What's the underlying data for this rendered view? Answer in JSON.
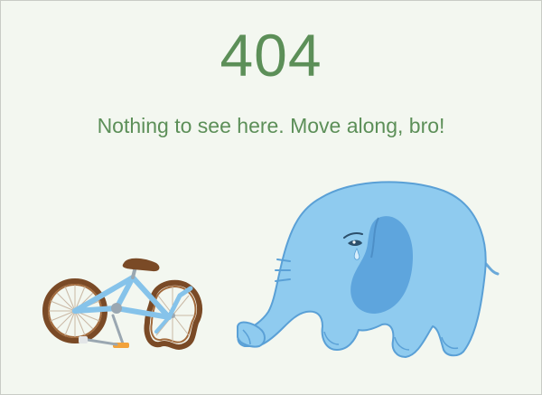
{
  "error": {
    "code": "404",
    "message": "Nothing to see here. Move along, bro!"
  },
  "illustration": {
    "bike_icon": "broken-bicycle",
    "elephant_icon": "sad-elephant"
  },
  "colors": {
    "background": "#f3f7f0",
    "text_green": "#5c8f58",
    "elephant_blue": "#8fcbef",
    "bike_blue": "#86c3ea"
  }
}
